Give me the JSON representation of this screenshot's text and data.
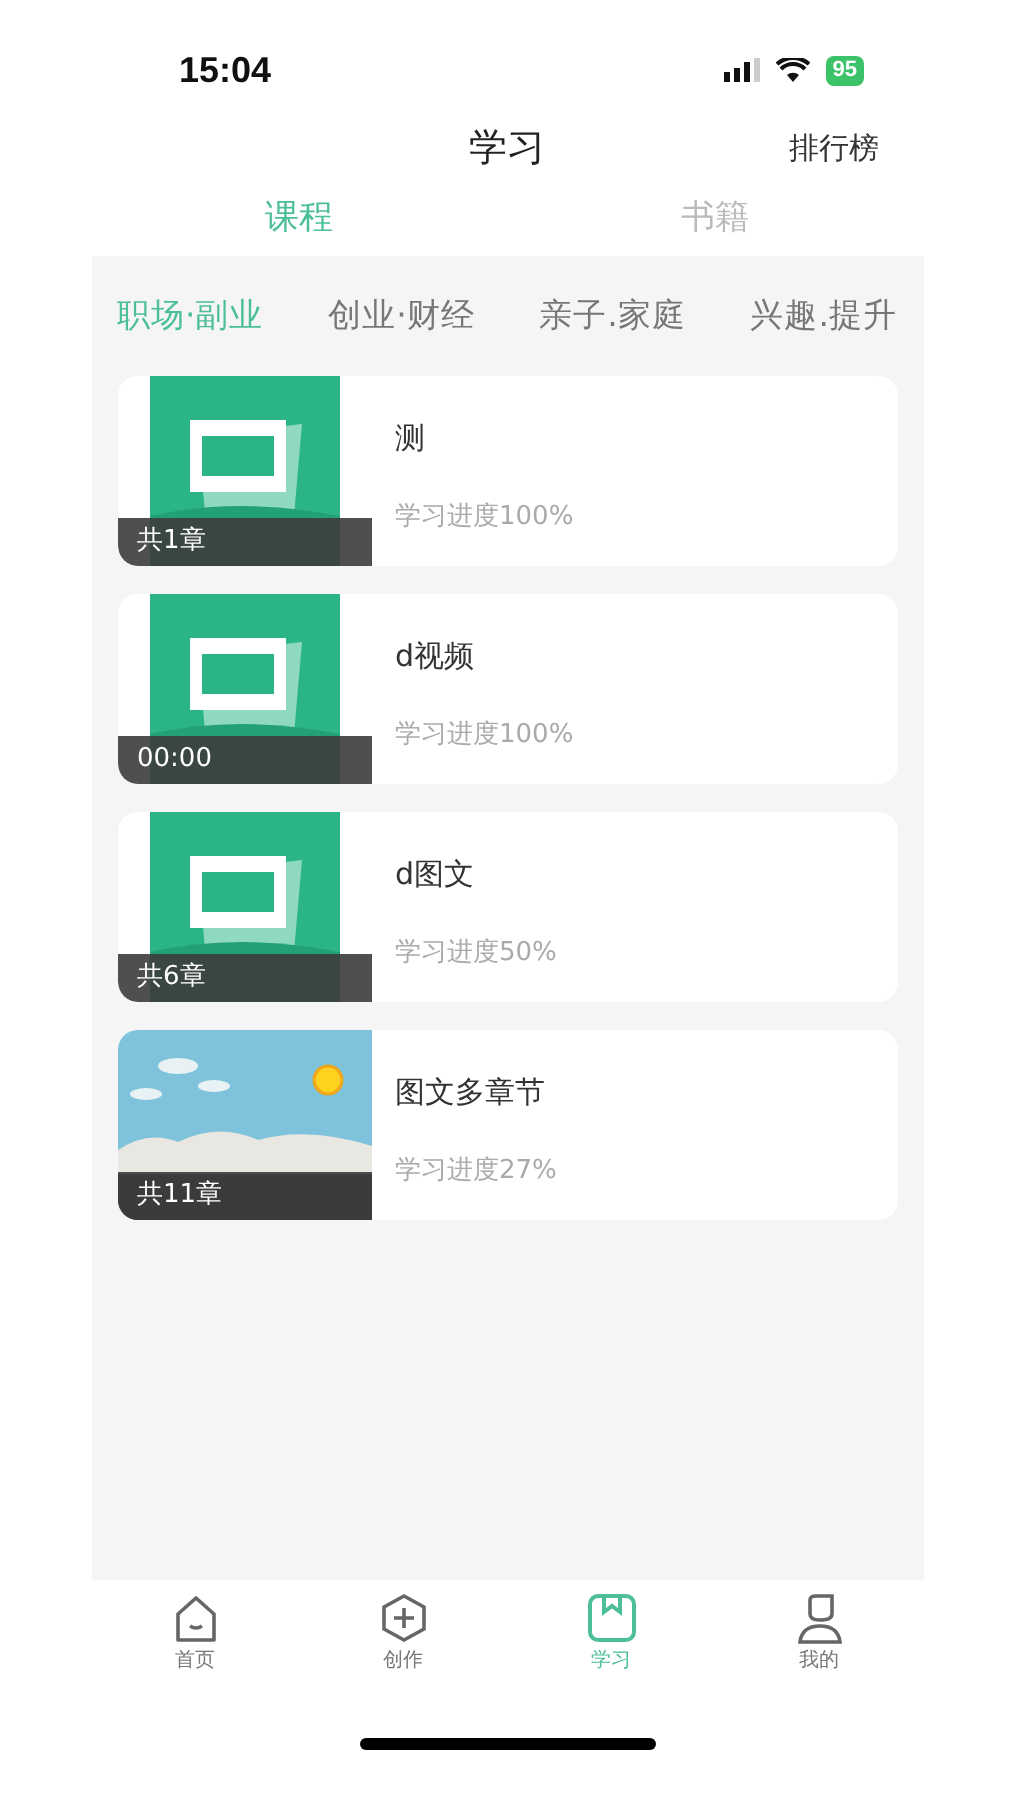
{
  "status_bar": {
    "time": "15:04",
    "battery": "95"
  },
  "header": {
    "title": "学习",
    "action": "排行榜"
  },
  "tabs": [
    {
      "label": "课程",
      "selected": true
    },
    {
      "label": "书籍",
      "selected": false
    }
  ],
  "categories": [
    {
      "label": "职场·副业",
      "selected": true
    },
    {
      "label": "创业·财经",
      "selected": false
    },
    {
      "label": "亲子.家庭",
      "selected": false
    },
    {
      "label": "兴趣.提升",
      "selected": false
    }
  ],
  "courses": [
    {
      "title": "测",
      "overlay": "共1章",
      "progress": "学习进度100%",
      "kind": "cover"
    },
    {
      "title": "d视频",
      "overlay": "00:00",
      "progress": "学习进度100%",
      "kind": "cover"
    },
    {
      "title": "d图文",
      "overlay": "共6章",
      "progress": "学习进度50%",
      "kind": "cover"
    },
    {
      "title": "图文多章节",
      "overlay": "共11章",
      "progress": "学习进度27%",
      "kind": "scene"
    }
  ],
  "bottom_nav": [
    {
      "label": "首页",
      "kind": "home",
      "selected": false
    },
    {
      "label": "创作",
      "kind": "create",
      "selected": false
    },
    {
      "label": "学习",
      "kind": "study",
      "selected": true
    },
    {
      "label": "我的",
      "kind": "profile",
      "selected": false
    }
  ]
}
